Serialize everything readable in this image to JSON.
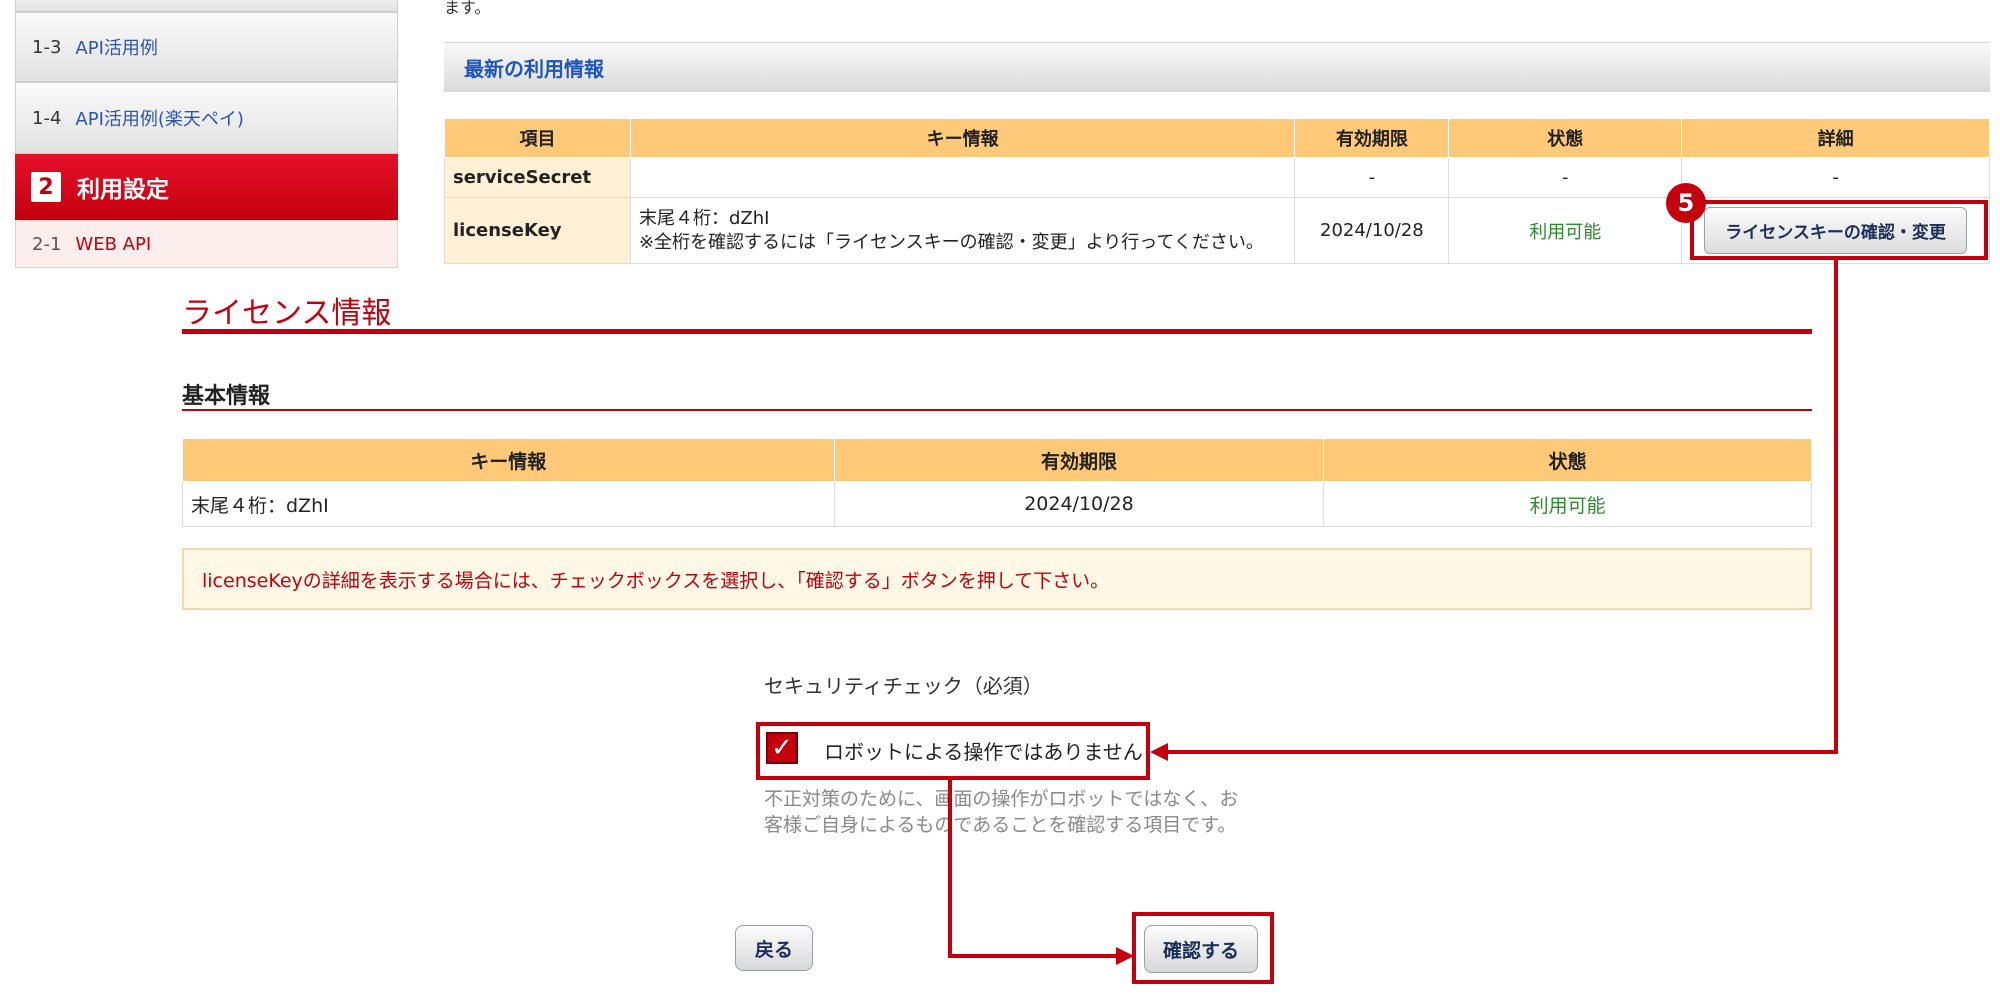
{
  "sidebar": {
    "items": [
      {
        "num": "1-3",
        "label": "API活用例"
      },
      {
        "num": "1-4",
        "label": "API活用例(楽天ペイ)"
      }
    ],
    "section": {
      "num": "2",
      "label": "利用設定"
    },
    "sub_item": {
      "num": "2-1",
      "label": "WEB API"
    }
  },
  "top_tail_text": "ます。",
  "usage": {
    "title": "最新の利用情報",
    "headers": [
      "項目",
      "キー情報",
      "有効期限",
      "状態",
      "詳細"
    ],
    "rows": [
      {
        "item": "serviceSecret",
        "key_info": "",
        "expiry": "-",
        "status": "-",
        "detail": "-"
      },
      {
        "item": "licenseKey",
        "key_info_line1": "末尾４桁：dZhI",
        "key_info_line2": "※全桁を確認するには「ライセンスキーの確認・変更」より行ってください。",
        "expiry": "2024/10/28",
        "status": "利用可能",
        "detail_button": "ライセンスキーの確認・変更"
      }
    ]
  },
  "step_badge": "5",
  "license": {
    "title": "ライセンス情報",
    "basic_title": "基本情報",
    "headers": [
      "キー情報",
      "有効期限",
      "状態"
    ],
    "row": {
      "key_info": "末尾４桁：dZhI",
      "expiry": "2024/10/28",
      "status": "利用可能"
    },
    "notice": "licenseKeyの詳細を表示する場合には、チェックボックスを選択し、「確認する」ボタンを押して下さい。",
    "security_label": "セキュリティチェック（必須）",
    "checkbox_label": "ロボットによる操作ではありません",
    "checkbox_checked": true,
    "security_desc": "不正対策のために、画面の操作がロボットではなく、お客様ご自身によるものであることを確認する項目です。",
    "back_button": "戻る",
    "confirm_button": "確認する"
  },
  "colors": {
    "accent": "#c4000e",
    "header_orange": "#ffc978",
    "link_blue": "#2a55b8",
    "available_green": "#2e8a2e"
  }
}
